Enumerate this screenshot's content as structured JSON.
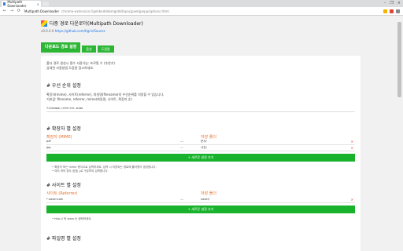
{
  "browser": {
    "tab_title": "Multipath Downloader",
    "tab_close": "×",
    "window_controls": [
      "–",
      "❐",
      "×"
    ],
    "address_title": "Multipath Downloader",
    "address_path": "chrome-extension://gehbeddebmgohbfepacjpaehjpepp/options.html",
    "nav": {
      "back": "←",
      "forward": "→",
      "reload": "⟳"
    }
  },
  "page": {
    "title": "다중 경로 다운로더(Multipath Downloader)",
    "version": "v0.0.4.0",
    "repo_link": "https://github.com/tigris/Sauces",
    "tabs": [
      "다운로드 경로 설정",
      "옵션",
      "도움말"
    ],
    "intro": [
      "폴더 경로 생성시 필수 사용가능: 프로필 수 (추천기)",
      "상세한 사용방법 도움말 참고하세요."
    ],
    "save_section": {
      "title": "# 우선 순위 설정",
      "desc": [
        "확장자(mime), 사이트(referrer), 파일명(filename)의 우선순위를 지정할 수 있습니다.",
        "기본값: filename, referrer, mime(파일명, 사이트, 확장자 순)"
      ],
      "value": "filename,referrer,mime"
    },
    "mime_section": {
      "title": "# 확장자 별 설정",
      "col_left": "확장자 (MIME)",
      "col_right": "저장 폴더",
      "rows": [
        {
          "left": "pdf",
          "right": "문서/"
        },
        {
          "left": "jpg",
          "right": "사진/"
        }
      ],
      "add_label": "+ 새로운 설정 추가",
      "notes": [
        "확장자 또는 mime 형식으로 입력하세요. 입력 시 저장되는 경로에 폴더명이 생성됩니다.",
        "여러 개의 경우 쉼표(,)로 구분하여 입력합니다."
      ]
    },
    "site_section": {
      "title": "# 사이트 별 설정",
      "col_left": "사이트 (Referrer)",
      "col_right": "저장 폴더",
      "rows": [
        {
          "left": "*.naver.com",
          "right": "naver/"
        }
      ],
      "add_label": "+ 새로운 설정 추가",
      "notes": [
        "http:// 와 www 는 생략하세요."
      ]
    },
    "next_section": {
      "title": "# 파일명 별 설정"
    }
  }
}
